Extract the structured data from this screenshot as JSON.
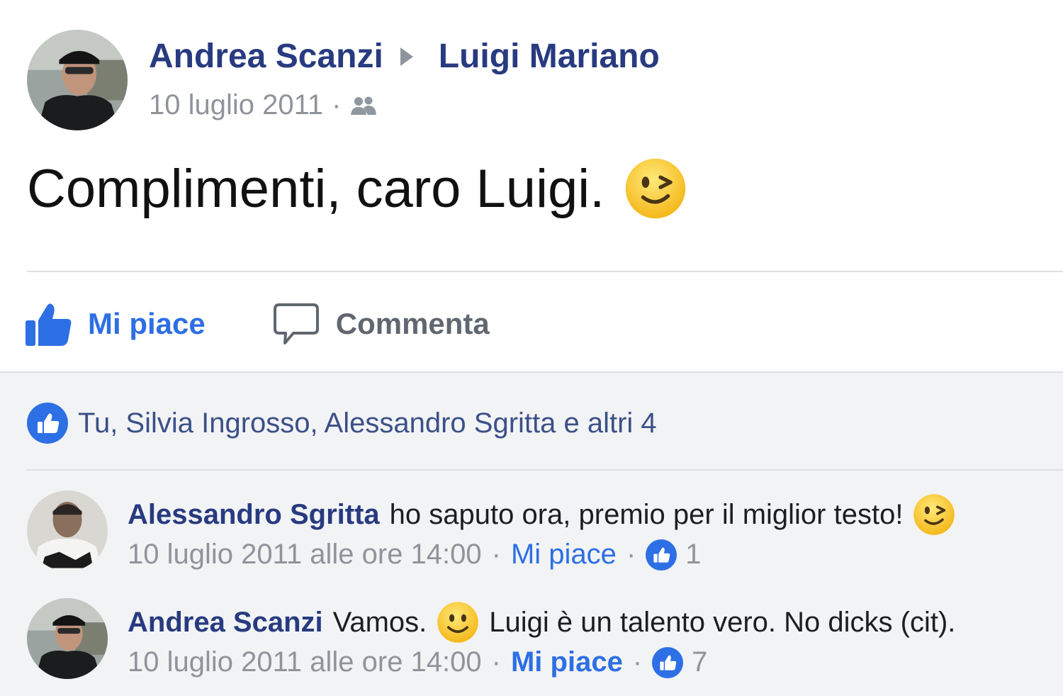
{
  "post": {
    "author": "Andrea Scanzi",
    "recipient": "Luigi Mariano",
    "date": "10 luglio 2011",
    "separator": "·",
    "audience_icon": "friends-icon",
    "text": "Complimenti, caro Luigi.",
    "text_emoji": "wink-emoji"
  },
  "actions": {
    "like_label": "Mi piace",
    "comment_label": "Commenta"
  },
  "likes": {
    "summary": "Tu, Silvia Ingrosso, Alessandro Sgritta e altri 4"
  },
  "comments": [
    {
      "author": "Alessandro Sgritta",
      "text_before": "ho saputo ora, premio per il miglior testo!",
      "emoji": "wink-emoji",
      "text_after": "",
      "timestamp": "10 luglio 2011 alle ore 14:00",
      "separator": "·",
      "like_label": "Mi piace",
      "like_count": "1"
    },
    {
      "author": "Andrea Scanzi",
      "text_before": "Vamos.",
      "emoji": "smile-emoji",
      "text_after": "Luigi è un talento vero. No dicks (cit).",
      "timestamp": "10 luglio 2011 alle ore 14:00",
      "separator": "·",
      "like_label": "Mi piace",
      "like_count": "7"
    }
  ],
  "colors": {
    "name_link": "#283b80",
    "like_blue": "#2d6fe4",
    "meta_grey": "#8f949b",
    "lower_background": "#f2f3f5",
    "emoji_yellow": "#f9c623"
  }
}
